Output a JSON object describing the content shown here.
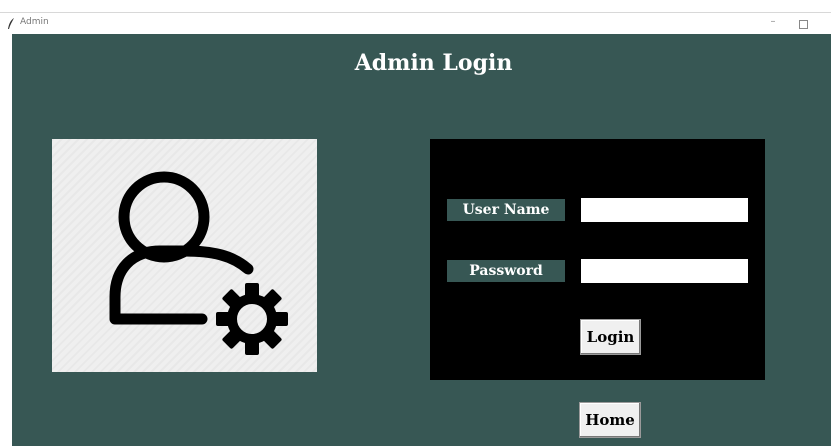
{
  "window": {
    "title": "Admin",
    "minimize_label": "–"
  },
  "page": {
    "title": "Admin Login"
  },
  "login_form": {
    "username_label": "User Name",
    "username_value": "",
    "password_label": "Password",
    "password_value": "",
    "login_button_label": "Login"
  },
  "home_button_label": "Home",
  "colors": {
    "background": "#375754",
    "form_panel": "#000000",
    "label_background": "#375754"
  },
  "icons": {
    "window_icon": "feather-icon",
    "user_image": "user-settings-icon"
  }
}
